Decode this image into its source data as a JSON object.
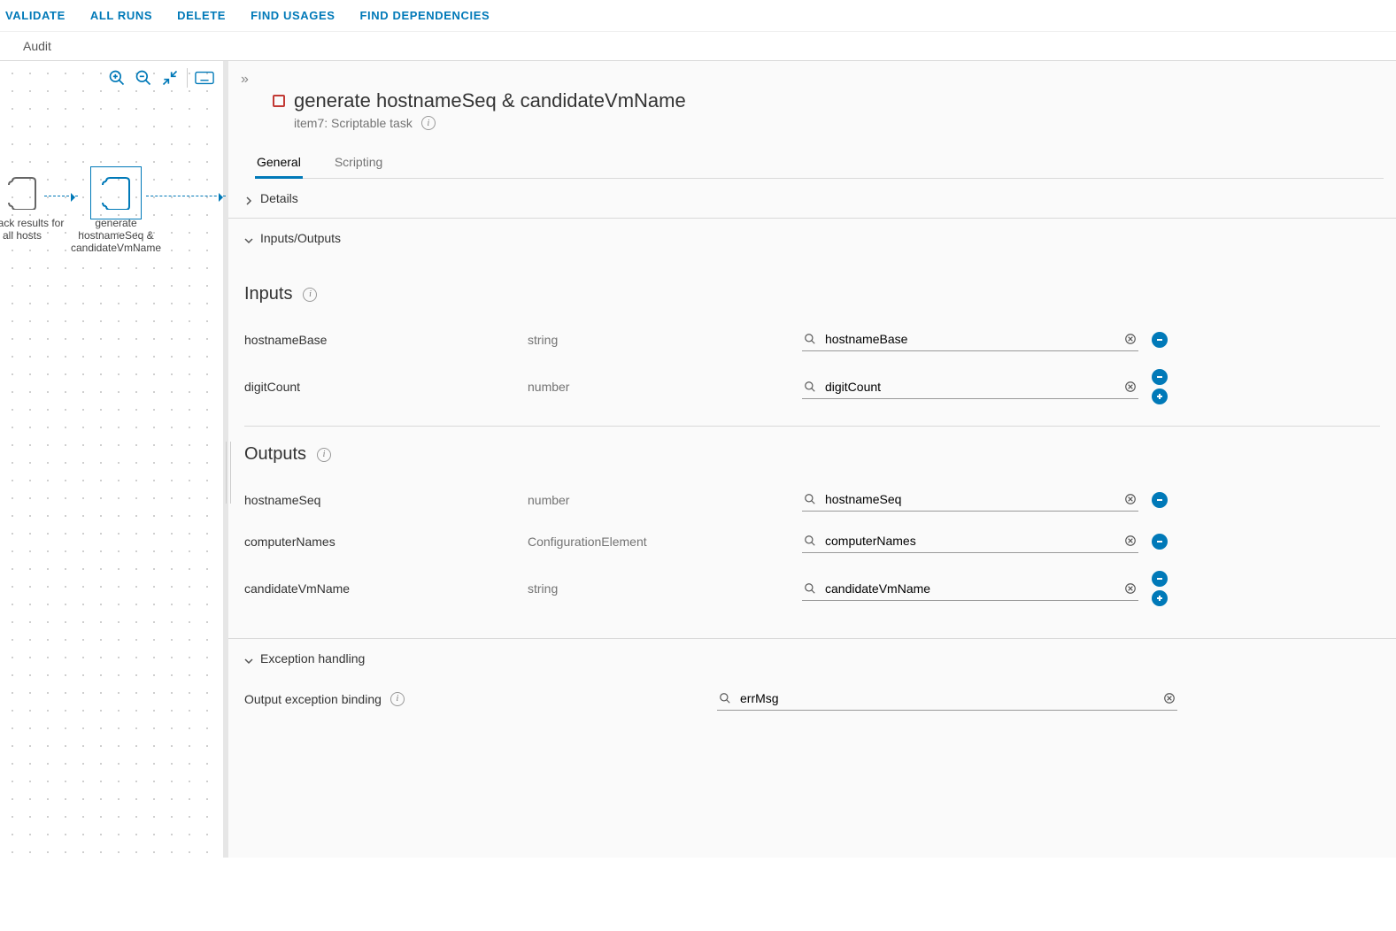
{
  "toolbar": {
    "validate": "VALIDATE",
    "allruns": "ALL RUNS",
    "delete": "DELETE",
    "findusages": "FIND USAGES",
    "finddeps": "FIND DEPENDENCIES"
  },
  "audit": {
    "label": "Audit"
  },
  "canvas": {
    "node1": "unpack results for all hosts",
    "node2": "generate hostnameSeq & candidateVmName"
  },
  "header": {
    "title": "generate hostnameSeq & candidateVmName",
    "subtitle": "item7: Scriptable task"
  },
  "tabs": {
    "general": "General",
    "scripting": "Scripting"
  },
  "sections": {
    "details": "Details",
    "io": "Inputs/Outputs",
    "exception": "Exception handling"
  },
  "inputs": {
    "title": "Inputs",
    "rows": [
      {
        "name": "hostnameBase",
        "type": "string",
        "binding": "hostnameBase",
        "add": false
      },
      {
        "name": "digitCount",
        "type": "number",
        "binding": "digitCount",
        "add": true
      }
    ]
  },
  "outputs": {
    "title": "Outputs",
    "rows": [
      {
        "name": "hostnameSeq",
        "type": "number",
        "binding": "hostnameSeq",
        "add": false
      },
      {
        "name": "computerNames",
        "type": "ConfigurationElement",
        "binding": "computerNames",
        "add": false
      },
      {
        "name": "candidateVmName",
        "type": "string",
        "binding": "candidateVmName",
        "add": true
      }
    ]
  },
  "exception": {
    "label": "Output exception binding",
    "value": "errMsg"
  }
}
